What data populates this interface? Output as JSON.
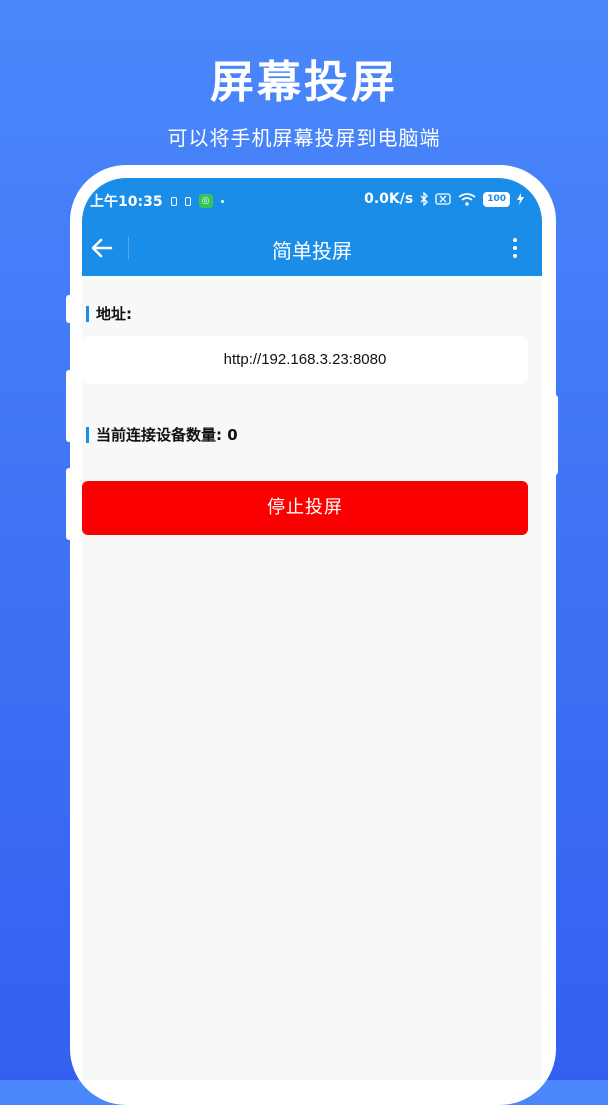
{
  "promo": {
    "title": "屏幕投屏",
    "subtitle": "可以将手机屏幕投屏到电脑端"
  },
  "statusbar": {
    "time": "上午10:35",
    "network_speed": "0.0K/s",
    "battery": "100"
  },
  "toolbar": {
    "title": "简单投屏",
    "back_icon": "arrow-left-icon",
    "more_icon": "more-vertical-icon"
  },
  "main": {
    "address_label": "地址:",
    "address_value": "http://192.168.3.23:8080",
    "device_count_label": "当前连接设备数量: 0",
    "stop_button_label": "停止投屏"
  },
  "colors": {
    "appbar": "#1a8de8",
    "stop_button": "#fb0000",
    "background_top": "#4a88fb",
    "background_bottom": "#355ff0"
  }
}
